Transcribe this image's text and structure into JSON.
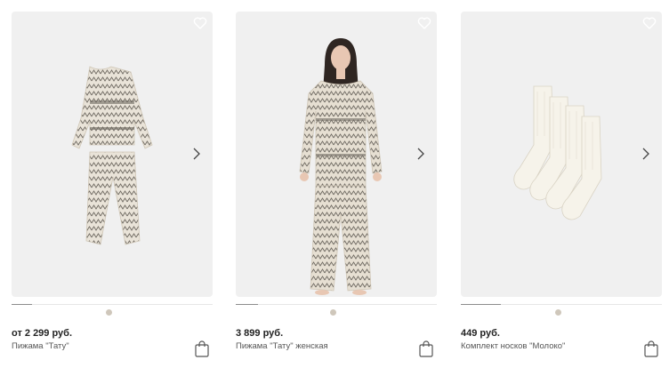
{
  "products": [
    {
      "price": "от 2 299 руб.",
      "name": "Пижама \"Тату\"",
      "image_alt": "pajama-kids",
      "progress": 0.1,
      "favorite_icon": "heart-icon",
      "next_icon": "chevron-right-icon",
      "cart_icon": "shopping-bag-icon"
    },
    {
      "price": "3 899 руб.",
      "name": "Пижама \"Тату\" женская",
      "image_alt": "pajama-women-model",
      "progress": 0.11,
      "favorite_icon": "heart-icon",
      "next_icon": "chevron-right-icon",
      "cart_icon": "shopping-bag-icon"
    },
    {
      "price": "449 руб.",
      "name": "Комплект носков \"Молоко\"",
      "image_alt": "socks-set",
      "progress": 0.2,
      "favorite_icon": "heart-icon",
      "next_icon": "chevron-right-icon",
      "cart_icon": "shopping-bag-icon"
    }
  ],
  "colors": {
    "card_bg": "#f0f0f0",
    "fabric": "#e9e3d8",
    "pattern": "#6f6a62",
    "socks": "#f6f3ea",
    "dot": "#cfc7bb"
  }
}
